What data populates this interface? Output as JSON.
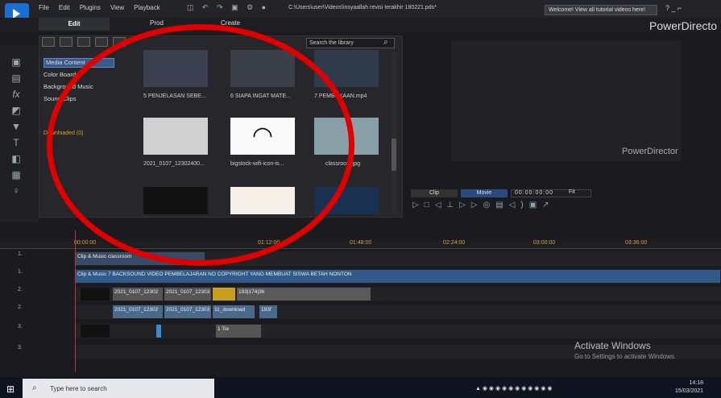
{
  "app": {
    "menu": [
      "File",
      "Edit",
      "Plugins",
      "View",
      "Playback"
    ],
    "file_path": "C:\\Users\\user\\Videos\\insyaallah revisi terakhir 180221.pds*",
    "welcome": "Welcome! View all tutorial videos here!",
    "window_controls": "? _ ⌐",
    "tabs": {
      "edit": "Edit",
      "produce": "Prod",
      "create": "Create"
    },
    "brand": "PowerDirecto"
  },
  "library": {
    "search_placeholder": "Search the library",
    "categories": [
      "Media Content",
      "Color Boards",
      "Background Music",
      "Sound Clips"
    ],
    "downloaded": "Downloaded  (0)",
    "items": [
      {
        "label": "5 PENJELASAN SEBE..."
      },
      {
        "label": "6 SIAPA INGAT MATE..."
      },
      {
        "label": "7 PEMBUKAAN.mp4"
      },
      {
        "label": "2021_0107_12302400..."
      },
      {
        "label": "bigstock-wifi-icon-is..."
      },
      {
        "label": "classroom.jpg"
      }
    ]
  },
  "preview": {
    "watermark": "PowerDirector",
    "clip_label": "Clip",
    "movie_label": "Movie",
    "timecode": "00:00:00:00",
    "fit": "Fit"
  },
  "timeline": {
    "ruler": [
      "00:00:00",
      "01:12:00",
      "01:48:00",
      "02:24:00",
      "03:00:00",
      "03:36:00"
    ],
    "tracks": [
      {
        "name": "1."
      },
      {
        "name": "1."
      },
      {
        "name": "2."
      },
      {
        "name": "2."
      },
      {
        "name": "3."
      },
      {
        "name": "3."
      }
    ],
    "clips": {
      "clip_music": "Clip & Music",
      "classroom": "classroom",
      "backsound": "Clip & Music  7 BACKSOUND VIDEO PEMBELAJARAN NO COPYRIGHT YANG MEMBUAT SISWA BETAH NONTON",
      "v1": "2021_0107_12302",
      "v2": "2021_0107_12303",
      "v3": "193|174|36",
      "a1": "2021_0107_12302",
      "a2": "2021_0107_12303",
      "a3": "11_download",
      "a4": "193f",
      "c1": "1 Tie"
    }
  },
  "activate": {
    "title": "Activate Windows",
    "sub": "Go to Settings to activate Windows."
  },
  "taskbar": {
    "search": "Type here to search",
    "time": "14:18",
    "date": "15/03/2021"
  }
}
